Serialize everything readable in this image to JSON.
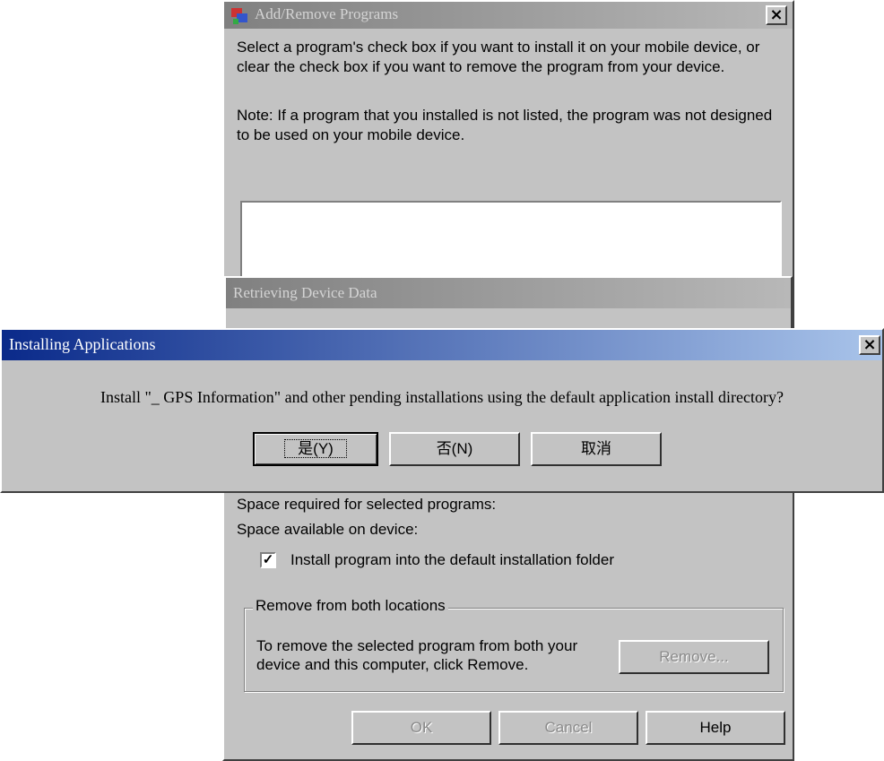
{
  "add_remove": {
    "title": "Add/Remove Programs",
    "intro": "Select a program's check box if you want to install it on your mobile device, or clear the check box if you want to remove the program from your device.",
    "note": "Note:  If a program that you installed is not listed, the program was not designed to be used on your mobile device.",
    "space_required_label": "Space required for selected programs:",
    "space_available_label": "Space available on device:",
    "install_default_checkbox": {
      "label": "Install program into the default installation folder",
      "checked": true
    },
    "remove_group": {
      "legend": "Remove from both locations",
      "description": "To remove the selected program from both your device and this computer, click Remove.",
      "remove_button": "Remove..."
    },
    "buttons": {
      "ok": "OK",
      "cancel": "Cancel",
      "help": "Help"
    }
  },
  "retrieving": {
    "title": "Retrieving Device Data"
  },
  "installing": {
    "title": "Installing Applications",
    "message": "Install \"_ GPS Information\" and other pending installations using the default application install directory?",
    "buttons": {
      "yes": "是(Y)",
      "no": "否(N)",
      "cancel": "取消"
    }
  },
  "colors": {
    "dialog_bg": "#c3c3c3",
    "active_title_start": "#0a2a8a",
    "active_title_end": "#a9c4ea"
  }
}
